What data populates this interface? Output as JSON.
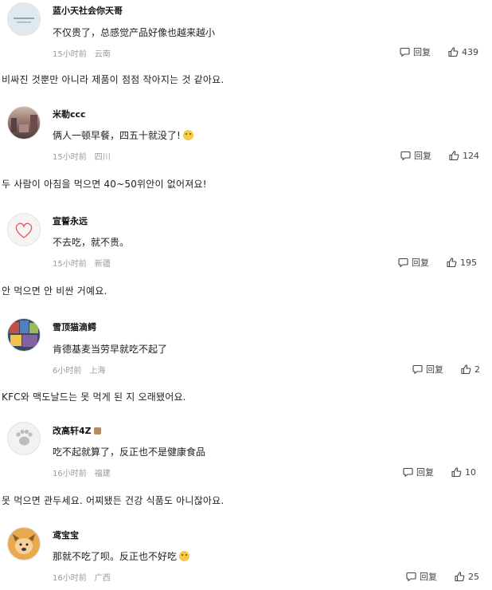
{
  "comments": [
    {
      "user": "蓝小天社会你天哥",
      "text": "不仅贵了，总感觉产品好像也越来越小",
      "time": "15小时前",
      "location": "云南",
      "reply_label": "回复",
      "likes": "439",
      "translation": "비싸진 것뿐만 아니라 제품이 점점 작아지는 것 같아요.",
      "avatar_icon": "text-avatar-icon"
    },
    {
      "user": "米勒ccc",
      "text": "俩人一顿早餐，四五十就没了!",
      "time": "15小时前",
      "location": "四川",
      "reply_label": "回复",
      "likes": "124",
      "translation": "두 사람이 아침을 먹으면 40~50위안이 없어져요!",
      "avatar_icon": "street-photo-avatar-icon"
    },
    {
      "user": "宣誓永远",
      "text": "不去吃，就不贵。",
      "time": "15小时前",
      "location": "新疆",
      "reply_label": "回复",
      "likes": "195",
      "translation": "안 먹으면 안 비싼 거예요.",
      "avatar_icon": "heart-avatar-icon"
    },
    {
      "user": "雪顶猫滴鳄",
      "text": "肯德基麦当劳早就吃不起了",
      "time": "6小时前",
      "location": "上海",
      "reply_label": "回复",
      "likes": "2",
      "translation": "KFC와 맥도날드는 못 먹게 된 지 오래됐어요.",
      "avatar_icon": "collage-avatar-icon"
    },
    {
      "user": "改高轩4Z",
      "text": "吃不起就算了，反正也不是健康食品",
      "time": "16小时前",
      "location": "福建",
      "reply_label": "回复",
      "likes": "10",
      "translation": "못 먹으면 관두세요. 어찌됐든 건강 식품도 아니잖아요.",
      "avatar_icon": "paw-avatar-icon"
    },
    {
      "user": "鸢宝宝",
      "text": "那就不吃了呗。反正也不好吃",
      "time": "16小时前",
      "location": "广西",
      "reply_label": "回复",
      "likes": "25",
      "translation": "",
      "avatar_icon": "dog-avatar-icon"
    }
  ]
}
